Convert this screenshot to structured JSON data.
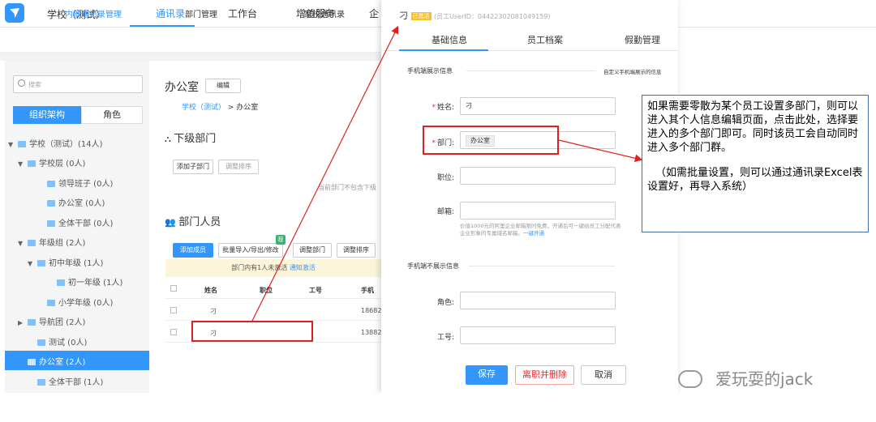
{
  "app": {
    "title": "学校（测试）",
    "nav": [
      "通讯录",
      "工作台",
      "增值服务",
      "企"
    ],
    "subnav": [
      "内部通讯录管理",
      "部门管理",
      "家校通讯录"
    ]
  },
  "sidebar": {
    "search_placeholder": "搜索",
    "tab_org": "组织架构",
    "tab_role": "角色",
    "tree": [
      {
        "label": "学校（测试）(14人)",
        "arrow": "▼"
      },
      {
        "label": "学校层 (0人)",
        "arrow": "▼"
      },
      {
        "label": "领导班子 (0人)",
        "arrow": ""
      },
      {
        "label": "办公室 (0人)",
        "arrow": ""
      },
      {
        "label": "全体干部 (0人)",
        "arrow": ""
      },
      {
        "label": "年级组 (2人)",
        "arrow": "▼"
      },
      {
        "label": "初中年级 (1人)",
        "arrow": "▼"
      },
      {
        "label": "初一年级 (1人)",
        "arrow": ""
      },
      {
        "label": "小学年级 (0人)",
        "arrow": ""
      },
      {
        "label": "导航团 (2人)",
        "arrow": "▶"
      },
      {
        "label": "测试 (0人)",
        "arrow": ""
      },
      {
        "label": "办公室 (2人)",
        "arrow": ""
      },
      {
        "label": "全体干部 (1人)",
        "arrow": ""
      }
    ]
  },
  "main": {
    "title": "办公室",
    "edit_btn": "编辑",
    "breadcrumb_link": "学校（测试）",
    "breadcrumb_current": "> 办公室",
    "sub_dept_title": "下级部门",
    "add_sub_dept": "添加子部门",
    "adjust_order": "调整排序",
    "sub_dept_note": "当前部门不包含下级",
    "members_title": "部门人员",
    "btn_add_member": "添加成员",
    "btn_batch": "批量导入/导出/修改",
    "btn_adjust_dept": "调整部门",
    "btn_adjust_order": "调整排序",
    "badge": "荐",
    "notice_text": "部门内有1人未激活",
    "notice_link": "通知激活",
    "table_headers": [
      "姓名",
      "职位",
      "工号",
      "手机"
    ],
    "rows": [
      {
        "name": "刁",
        "phone": "18682"
      },
      {
        "name": "刁",
        "phone": "13882"
      }
    ]
  },
  "modal": {
    "name_prefix": "刁",
    "status": "已激活",
    "uid": "(员工UserID：044223020810491​59)",
    "tabs": [
      "基础信息",
      "员工档案",
      "假勤管理"
    ],
    "section_show": "手机端展示信息",
    "custom_link": "自定义手机端展示的信息",
    "fields": {
      "name_label": "姓名:",
      "name_value": "刁",
      "dept_label": "部门:",
      "dept_value": "办公室",
      "position_label": "职位:",
      "email_label": "邮箱:",
      "email_help": "价值1000元的阿里企业邮箱限时免费，开通后可一键给员工分配代表企业形象的专属域名邮箱。",
      "email_help_link": "一键开通",
      "section_hidden": "手机端不展示信息",
      "role_label": "角色:",
      "jobno_label": "工号:"
    },
    "btn_save": "保存",
    "btn_resign": "离职并删除",
    "btn_cancel": "取消"
  },
  "callout": {
    "p1": "如果需要零散为某个员工设置多部门，则可以进入其个人信息编辑页面，点击此处，选择要进入的多个部门即可。同时该员工会自动同时进入多个部门群。",
    "p2": "（如需批量设置，则可以通过通讯录Excel表设置好，再导入系统）"
  },
  "watermark": "爱玩耍的jack",
  "colors": {
    "accent": "#3296fa",
    "highlight": "#e02020"
  }
}
